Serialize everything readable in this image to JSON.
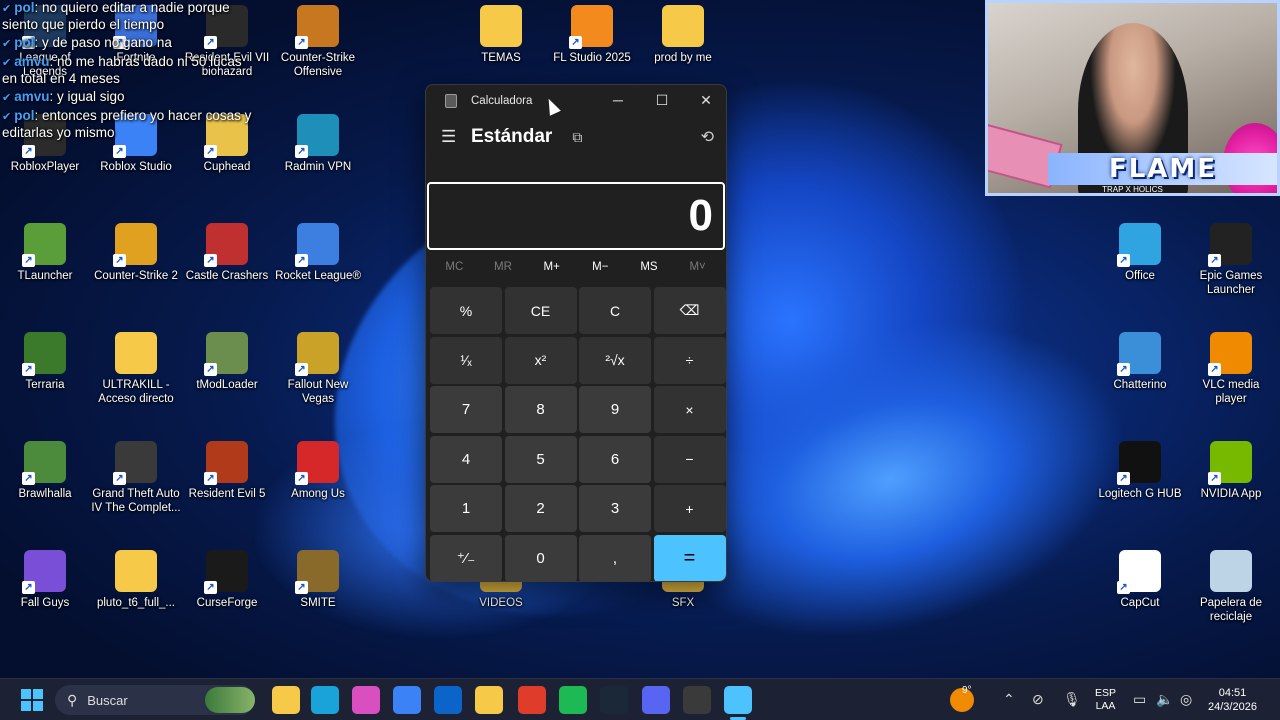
{
  "chat": [
    {
      "user": "pol",
      "text": ": no quiero editar a nadie porque siento que pierdo el tiempo"
    },
    {
      "user": "pol",
      "text": ": y de paso no gano na"
    },
    {
      "user": "amvu",
      "text": ": no me habras dado ni 50 lucas en total en 4 meses"
    },
    {
      "user": "amvu",
      "text": ": y igual sigo"
    },
    {
      "user": "pol",
      "text": ": entonces prefiero yo hacer cosas y editarlas yo mismo"
    }
  ],
  "webcam": {
    "banner": "FLAME",
    "sub": "TRAP X HOLICS"
  },
  "desktop_icons": [
    {
      "label": "League of Legends",
      "icon": "league-icon",
      "color": "#1e3a5f"
    },
    {
      "label": "Fortnite",
      "icon": "fortnite-icon",
      "color": "#3b6fd8"
    },
    {
      "label": "Resident Evil VII biohazard",
      "icon": "re7-icon",
      "color": "#2a2a2a"
    },
    {
      "label": "Counter-Strike Offensive",
      "icon": "csgo-icon",
      "color": "#c7771f"
    },
    {
      "label": "TEMAS",
      "icon": "folder-icon",
      "color": "#f7c948"
    },
    {
      "label": "FL Studio 2025",
      "icon": "flstudio-icon",
      "color": "#f28a1d"
    },
    {
      "label": "prod by me",
      "icon": "folder-icon",
      "color": "#f7c948"
    },
    {
      "label": "RobloxPlayer",
      "icon": "roblox-icon",
      "color": "#2b2b2b"
    },
    {
      "label": "Roblox Studio",
      "icon": "roblox-studio-icon",
      "color": "#3b82f6"
    },
    {
      "label": "Cuphead",
      "icon": "cuphead-icon",
      "color": "#e9c24a"
    },
    {
      "label": "Radmin VPN",
      "icon": "radmin-icon",
      "color": "#1d8fb8"
    },
    {
      "label": "TLauncher",
      "icon": "tlauncher-icon",
      "color": "#5a9e3a"
    },
    {
      "label": "Counter-Strike 2",
      "icon": "cs2-icon",
      "color": "#e0a020"
    },
    {
      "label": "Castle Crashers",
      "icon": "castle-crashers-icon",
      "color": "#c03030"
    },
    {
      "label": "Rocket League®",
      "icon": "rocket-league-icon",
      "color": "#3d7fe0"
    },
    {
      "label": "Terraria",
      "icon": "terraria-icon",
      "color": "#3a7a2a"
    },
    {
      "label": "ULTRAKILL - Acceso directo",
      "icon": "folder-icon",
      "color": "#f7c948"
    },
    {
      "label": "tModLoader",
      "icon": "tmodloader-icon",
      "color": "#6b8e4e"
    },
    {
      "label": "Fallout New Vegas",
      "icon": "fallout-icon",
      "color": "#c9a227"
    },
    {
      "label": "Brawlhalla",
      "icon": "brawlhalla-icon",
      "color": "#4c8a3c"
    },
    {
      "label": "Grand Theft Auto IV The Complet...",
      "icon": "gta4-icon",
      "color": "#3a3a3a"
    },
    {
      "label": "Resident Evil 5",
      "icon": "re5-icon",
      "color": "#b03a1a"
    },
    {
      "label": "Among Us",
      "icon": "among-us-icon",
      "color": "#d62828"
    },
    {
      "label": "Fall Guys",
      "icon": "fall-guys-icon",
      "color": "#7a4fd8"
    },
    {
      "label": "pluto_t6_full_...",
      "icon": "folder-icon",
      "color": "#f7c948"
    },
    {
      "label": "CurseForge",
      "icon": "curseforge-icon",
      "color": "#1a1a1a"
    },
    {
      "label": "SMITE",
      "icon": "smite-icon",
      "color": "#8a6a2a"
    },
    {
      "label": "VIDEOS",
      "icon": "folder-icon",
      "color": "#f7c948"
    },
    {
      "label": "SFX",
      "icon": "folder-icon",
      "color": "#f7c948"
    },
    {
      "label": "Office",
      "icon": "office-icon",
      "color": "#2fa4e0"
    },
    {
      "label": "Epic Games Launcher",
      "icon": "epic-games-icon",
      "color": "#222222"
    },
    {
      "label": "Chatterino",
      "icon": "chatterino-icon",
      "color": "#3b8fd8"
    },
    {
      "label": "VLC media player",
      "icon": "vlc-icon",
      "color": "#f08a00"
    },
    {
      "label": "Logitech G HUB",
      "icon": "logitech-icon",
      "color": "#111111"
    },
    {
      "label": "NVIDIA App",
      "icon": "nvidia-icon",
      "color": "#76b900"
    },
    {
      "label": "CapCut",
      "icon": "capcut-icon",
      "color": "#ffffff"
    },
    {
      "label": "Papelera de reciclaje",
      "icon": "recycle-bin-icon",
      "color": "#bcd4e6"
    }
  ],
  "calculator": {
    "window_title": "Calculadora",
    "mode": "Estándar",
    "display": "0",
    "memory": [
      {
        "label": "MC",
        "enabled": false
      },
      {
        "label": "MR",
        "enabled": false
      },
      {
        "label": "M+",
        "enabled": true
      },
      {
        "label": "M−",
        "enabled": true
      },
      {
        "label": "MS",
        "enabled": true
      },
      {
        "label": "M˅",
        "enabled": false
      }
    ],
    "keys": [
      {
        "label": "%",
        "type": "op",
        "name": "percent-button"
      },
      {
        "label": "CE",
        "type": "op",
        "name": "clear-entry-button"
      },
      {
        "label": "C",
        "type": "op",
        "name": "clear-button"
      },
      {
        "label": "⌫",
        "type": "op",
        "name": "backspace-button"
      },
      {
        "label": "¹⁄ₓ",
        "type": "op",
        "name": "reciprocal-button"
      },
      {
        "label": "x²",
        "type": "op",
        "name": "square-button"
      },
      {
        "label": "²√x",
        "type": "op",
        "name": "square-root-button"
      },
      {
        "label": "÷",
        "type": "op",
        "name": "divide-button"
      },
      {
        "label": "7",
        "type": "num",
        "name": "digit-7-button"
      },
      {
        "label": "8",
        "type": "num",
        "name": "digit-8-button"
      },
      {
        "label": "9",
        "type": "num",
        "name": "digit-9-button"
      },
      {
        "label": "×",
        "type": "op",
        "name": "multiply-button"
      },
      {
        "label": "4",
        "type": "num",
        "name": "digit-4-button"
      },
      {
        "label": "5",
        "type": "num",
        "name": "digit-5-button"
      },
      {
        "label": "6",
        "type": "num",
        "name": "digit-6-button"
      },
      {
        "label": "−",
        "type": "op",
        "name": "subtract-button"
      },
      {
        "label": "1",
        "type": "num",
        "name": "digit-1-button"
      },
      {
        "label": "2",
        "type": "num",
        "name": "digit-2-button"
      },
      {
        "label": "3",
        "type": "num",
        "name": "digit-3-button"
      },
      {
        "label": "+",
        "type": "op",
        "name": "add-button"
      },
      {
        "label": "⁺⁄₋",
        "type": "num",
        "name": "negate-button"
      },
      {
        "label": "0",
        "type": "num",
        "name": "digit-0-button"
      },
      {
        "label": ",",
        "type": "num",
        "name": "decimal-button"
      },
      {
        "label": "=",
        "type": "equals",
        "name": "equals-button"
      }
    ]
  },
  "taskbar": {
    "search_placeholder": "Buscar",
    "weather": "9°",
    "lang_top": "ESP",
    "lang_bottom": "LAA",
    "time": "04:51",
    "date": "24/3/2026",
    "apps": [
      {
        "icon": "file-explorer-folder-icon",
        "color": "#f7c948"
      },
      {
        "icon": "edge-icon",
        "color": "#1aa3d8"
      },
      {
        "icon": "copilot-icon",
        "color": "#d94fbf"
      },
      {
        "icon": "store-icon",
        "color": "#3b82f6"
      },
      {
        "icon": "outlook-icon",
        "color": "#0a64c9"
      },
      {
        "icon": "file-explorer-icon",
        "color": "#f7c948"
      },
      {
        "icon": "chrome-icon",
        "color": "#e03c2c"
      },
      {
        "icon": "spotify-icon",
        "color": "#1db954"
      },
      {
        "icon": "steam-icon",
        "color": "#1b2838"
      },
      {
        "icon": "discord-icon",
        "color": "#5865f2"
      },
      {
        "icon": "obs-icon",
        "color": "#3a3a3a"
      },
      {
        "icon": "calculator-icon",
        "color": "#4cc2ff"
      }
    ]
  }
}
